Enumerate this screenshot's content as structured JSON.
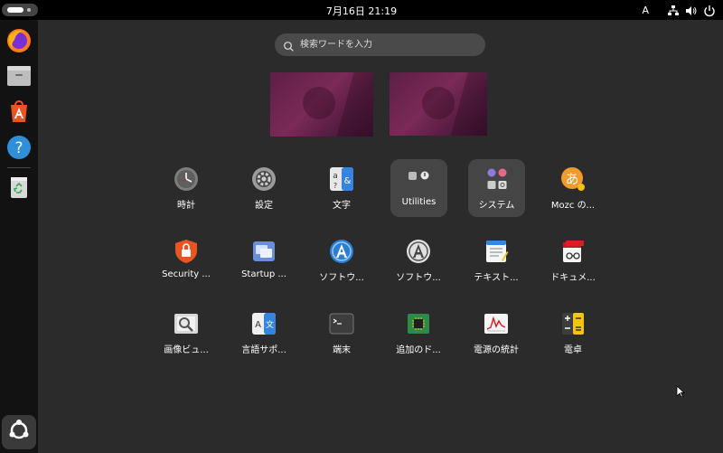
{
  "topbar": {
    "clock": "7月16日  21:19",
    "input_indicator": "A",
    "icons": [
      "network-icon",
      "volume-icon",
      "power-icon"
    ]
  },
  "dock": {
    "items": [
      {
        "name": "firefox",
        "icon": "firefox-icon"
      },
      {
        "name": "files",
        "icon": "files-icon"
      },
      {
        "name": "app-center",
        "icon": "app-center-icon"
      },
      {
        "name": "help",
        "icon": "help-icon"
      },
      {
        "name": "trash",
        "icon": "trash-icon"
      }
    ],
    "show_apps_icon": "ubuntu-logo-icon"
  },
  "search": {
    "placeholder": "検索ワードを入力"
  },
  "colors": {
    "background": "#2b2b2b",
    "topbar": "#000000",
    "dock": "#121212",
    "folder": "#454545",
    "accent": "#e95420"
  },
  "apps": {
    "row1": [
      {
        "label": "時計",
        "icon": "clock-icon"
      },
      {
        "label": "設定",
        "icon": "settings-icon"
      },
      {
        "label": "文字",
        "icon": "characters-icon"
      },
      {
        "label": "Utilities",
        "icon": "utilities-folder-icon"
      },
      {
        "label": "システム",
        "icon": "system-folder-icon"
      },
      {
        "label": "Mozc の...",
        "icon": "mozc-icon"
      }
    ],
    "row2": [
      {
        "label": "Security ...",
        "icon": "security-icon"
      },
      {
        "label": "Startup ...",
        "icon": "startup-icon"
      },
      {
        "label": "ソフトウ...",
        "icon": "software-updater-icon"
      },
      {
        "label": "ソフトウ...",
        "icon": "software-properties-icon"
      },
      {
        "label": "テキスト...",
        "icon": "text-editor-icon"
      },
      {
        "label": "ドキュメ...",
        "icon": "document-viewer-icon"
      }
    ],
    "row3": [
      {
        "label": "画像ビュ...",
        "icon": "image-viewer-icon"
      },
      {
        "label": "言語サポ...",
        "icon": "language-support-icon"
      },
      {
        "label": "端末",
        "icon": "terminal-icon"
      },
      {
        "label": "追加のド...",
        "icon": "additional-drivers-icon"
      },
      {
        "label": "電源の統計",
        "icon": "power-statistics-icon"
      },
      {
        "label": "電卓",
        "icon": "calculator-icon"
      }
    ]
  }
}
